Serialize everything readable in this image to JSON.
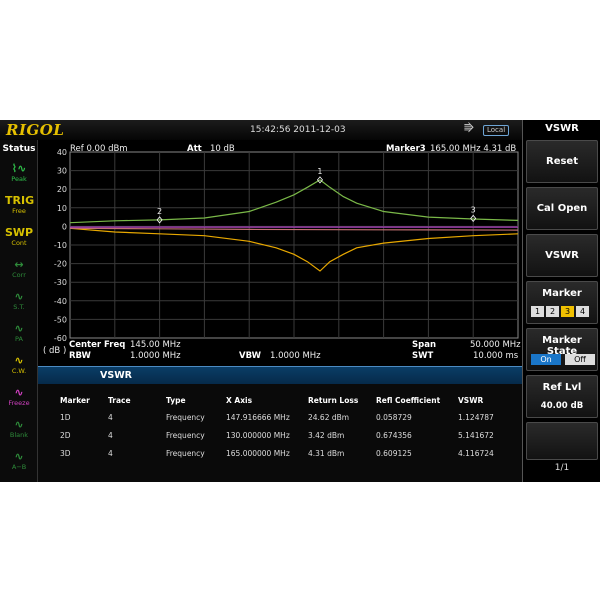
{
  "logo": "RIGOL",
  "datetime": "15:42:56 2011-12-03",
  "usb_icon": "usb-icon",
  "local_label": "Local",
  "status": {
    "title": "Status",
    "items": [
      {
        "glyph": "⌇∿",
        "label": "Peak",
        "color": "#2fbf4a"
      },
      {
        "glyph": "TRIG",
        "label": "Free",
        "color": "#d6c000"
      },
      {
        "glyph": "SWP",
        "label": "Cont",
        "color": "#d6c000"
      },
      {
        "glyph": "↔",
        "label": "Corr",
        "color": "#2e8b3a"
      },
      {
        "glyph": "∿",
        "label": "S.T.",
        "color": "#2e8b3a"
      },
      {
        "glyph": "∿",
        "label": "PA",
        "color": "#2e8b3a"
      },
      {
        "glyph": "∿",
        "label": "C.W.",
        "color": "#d6c000"
      },
      {
        "glyph": "∿",
        "label": "Freeze",
        "color": "#d040c0"
      },
      {
        "glyph": "∿",
        "label": "Blank",
        "color": "#2e8b3a"
      },
      {
        "glyph": "∿",
        "label": "A−B",
        "color": "#2e8b3a"
      }
    ]
  },
  "header": {
    "ref": "Ref  0.00 dBm",
    "att_label": "Att",
    "att_value": "10 dB",
    "marker_label": "Marker3",
    "marker_value": "165.00 MHz    4.31 dB"
  },
  "chart_data": {
    "type": "line",
    "ylim": [
      -60,
      40
    ],
    "yticks": [
      40,
      30,
      20,
      10,
      0,
      -10,
      -20,
      -30,
      -40,
      -50,
      -60
    ],
    "unit": "( dB )",
    "x_range_mhz": [
      120,
      170
    ],
    "grid": true,
    "series": [
      {
        "color": "#7ab848",
        "x": [
          120,
          125,
          130,
          135,
          140,
          143,
          145,
          146.5,
          147.9,
          149,
          150.5,
          152,
          155,
          160,
          165,
          170
        ],
        "y": [
          2,
          3,
          3.5,
          4.5,
          8,
          13,
          17,
          21,
          25,
          21,
          16,
          12.5,
          8,
          5,
          4,
          3.2
        ]
      },
      {
        "color": "#e8a800",
        "x": [
          120,
          125,
          130,
          135,
          140,
          143,
          145,
          146.5,
          147.9,
          149,
          150.5,
          152,
          155,
          160,
          165,
          170
        ],
        "y": [
          -1,
          -3,
          -4,
          -5,
          -8,
          -11.5,
          -15,
          -19,
          -24,
          -19,
          -15,
          -11.5,
          -9,
          -6.5,
          -5,
          -4
        ]
      },
      {
        "color": "#c07070",
        "x": [
          120,
          130,
          140,
          150,
          160,
          170
        ],
        "y": [
          -1,
          -1.3,
          -1.6,
          -1.8,
          -1.9,
          -2
        ]
      },
      {
        "color": "#b040c0",
        "x": [
          120,
          170
        ],
        "y": [
          -0.4,
          -0.4
        ]
      }
    ],
    "markers": [
      {
        "label": "1",
        "x": 147.9,
        "y": 25
      },
      {
        "label": "2",
        "x": 130.0,
        "y": 3.5
      },
      {
        "label": "3",
        "x": 165.0,
        "y": 4.3
      }
    ]
  },
  "footer": {
    "center_label": "Center Freq",
    "center_value": "145.00 MHz",
    "rbw_label": "RBW",
    "rbw_value": "1.0000 MHz",
    "vbw_label": "VBW",
    "vbw_value": "1.0000 MHz",
    "span_label": "Span",
    "span_value": "50.000 MHz",
    "swt_label": "SWT",
    "swt_value": "10.000 ms"
  },
  "vswr_table": {
    "title": "VSWR",
    "columns": [
      "Marker",
      "Trace",
      "Type",
      "X Axis",
      "Return Loss",
      "Refl Coefficient",
      "VSWR"
    ],
    "rows": [
      [
        "1D",
        "4",
        "Frequency",
        "147.916666 MHz",
        "24.62 dBm",
        "0.058729",
        "1.124787"
      ],
      [
        "2D",
        "4",
        "Frequency",
        "130.000000 MHz",
        "3.42 dBm",
        "0.674356",
        "5.141672"
      ],
      [
        "3D",
        "4",
        "Frequency",
        "165.000000 MHz",
        "4.31 dBm",
        "0.609125",
        "4.116724"
      ]
    ]
  },
  "menu": {
    "title": "VSWR",
    "reset": "Reset",
    "cal_open": "Cal Open",
    "vswr": "VSWR",
    "marker": "Marker",
    "marker_numbers": [
      "1",
      "2",
      "3",
      "4"
    ],
    "marker_selected": "3",
    "marker_state": "Marker State",
    "on": "On",
    "off": "Off",
    "ref_lvl": "Ref Lvl",
    "ref_lvl_value": "40.00 dB",
    "page": "1/1"
  }
}
